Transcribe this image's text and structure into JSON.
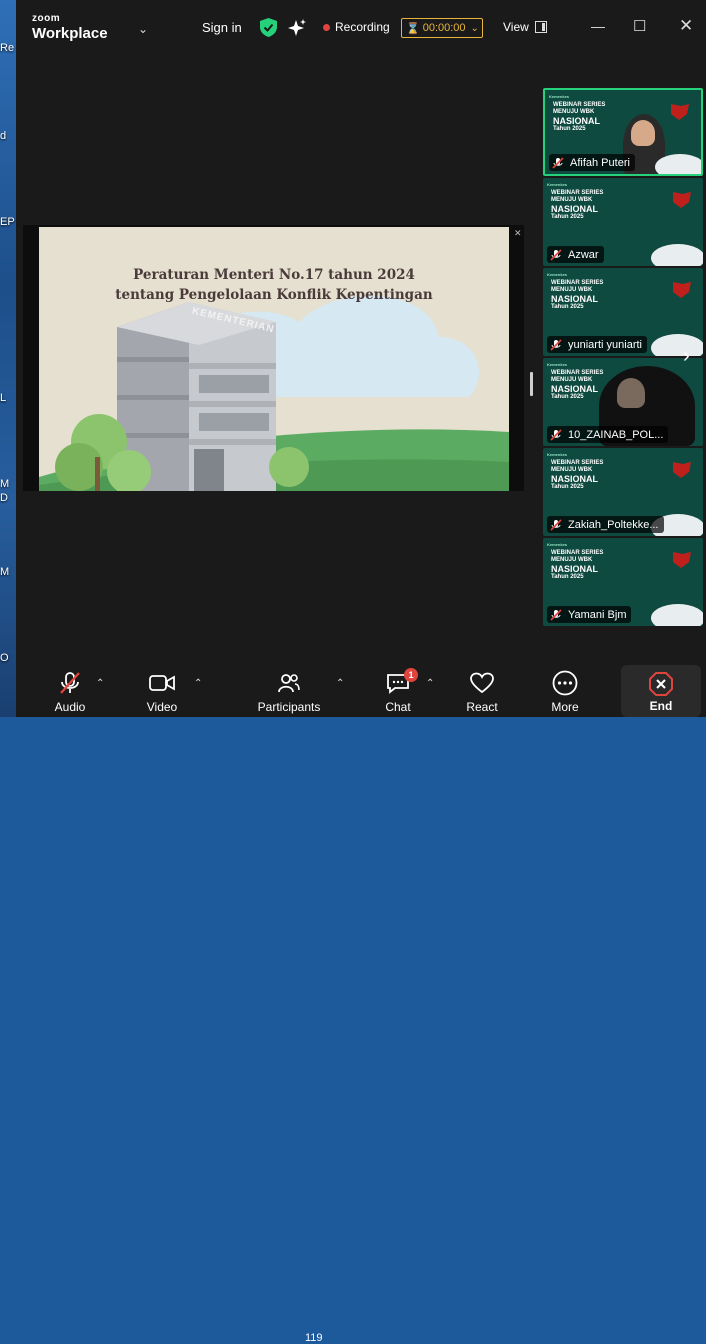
{
  "desktop": {
    "labels": [
      "Re",
      "d",
      "EP",
      "L",
      "M",
      "D",
      "M",
      "O"
    ]
  },
  "titlebar": {
    "logo_top": "zoom",
    "logo_bottom": "Workplace",
    "sign_in": "Sign in",
    "recording": "Recording",
    "timer": "00:00:00",
    "view": "View"
  },
  "share": {
    "slide_title_line1": "Peraturan Menteri No.17 tahun 2024",
    "slide_title_line2": "tentang Pengelolaan Konflik Kepentingan",
    "building_sign": "KEMENTERIAN"
  },
  "gallery": {
    "participants": [
      {
        "name": "Afifah Puteri",
        "active": true,
        "video": true
      },
      {
        "name": "Azwar",
        "active": false,
        "video": false
      },
      {
        "name": "yuniarti yuniarti",
        "active": false,
        "video": false
      },
      {
        "name": "10_ZAINAB_POL...",
        "active": false,
        "video": true
      },
      {
        "name": "Zakiah_Poltekke...",
        "active": false,
        "video": false
      },
      {
        "name": "Yamani Bjm",
        "active": false,
        "video": false
      }
    ],
    "tile_heading": {
      "org": "Kemenkes",
      "line1": "WEBINAR SERIES",
      "line2": "MENUJU WBK",
      "line3": "NASIONAL",
      "line4": "Tahun 2025"
    }
  },
  "toolbar": {
    "audio": "Audio",
    "video": "Video",
    "participants": "Participants",
    "participant_count": "119",
    "chat": "Chat",
    "chat_badge": "1",
    "react": "React",
    "more": "More",
    "end": "End"
  },
  "colors": {
    "accent_green": "#25d17a",
    "end_red": "#e0443e",
    "timer_gold": "#e7b53b",
    "tile_teal": "#0f4a40"
  }
}
